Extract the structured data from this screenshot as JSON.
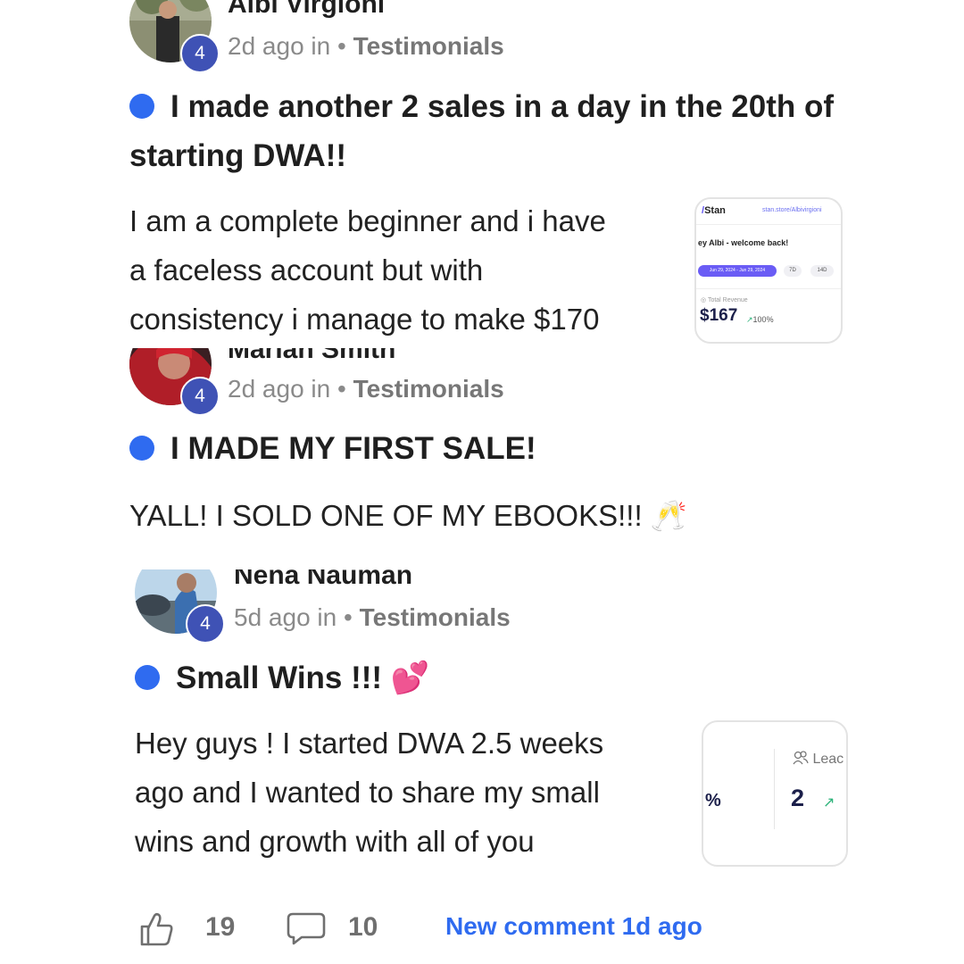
{
  "posts": [
    {
      "author": "Albi Virgioni",
      "level": "4",
      "time": "2d ago in",
      "sep": "•",
      "category": "Testimonials",
      "title_line1": "I made another 2 sales in a day in the 20th of",
      "title_line2": "starting DWA!!",
      "body": [
        "I am a complete beginner and i have",
        "a faceless account but with",
        "consistency i manage to make $170"
      ],
      "thumb": {
        "brand": "Stan",
        "url": "stan.store/Albivirgioni",
        "greeting": "ey Albi - welcome back!",
        "date_range": "Jun 29, 2024 - Jun 29, 2024",
        "chip1": "7D",
        "chip2": "14D",
        "revenue_label": "Total Revenue",
        "revenue": "$167",
        "change": "100%"
      }
    },
    {
      "author": "Mariah Smith",
      "level": "4",
      "time": "2d ago in",
      "sep": "•",
      "category": "Testimonials",
      "title": "I MADE MY FIRST SALE!",
      "body": "YALL! I SOLD ONE OF MY EBOOKS!!! 🥂"
    },
    {
      "author": "Nena Nauman",
      "level": "4",
      "time": "5d ago in",
      "sep": "•",
      "category": "Testimonials",
      "title": "Small Wins !!! 💕",
      "body": [
        "Hey guys ! I started DWA 2.5 weeks",
        "ago and I wanted to share my small",
        "wins and growth with all of you"
      ],
      "thumb": {
        "pct": "%",
        "leads_label": "Leac",
        "leads_value": "2"
      }
    }
  ],
  "footer": {
    "likes": "19",
    "comments": "10",
    "new_comment": "New comment 1d ago"
  },
  "colors": {
    "accent": "#2f6bf0",
    "badge": "#3f52b5",
    "muted": "#8a8a8a"
  }
}
